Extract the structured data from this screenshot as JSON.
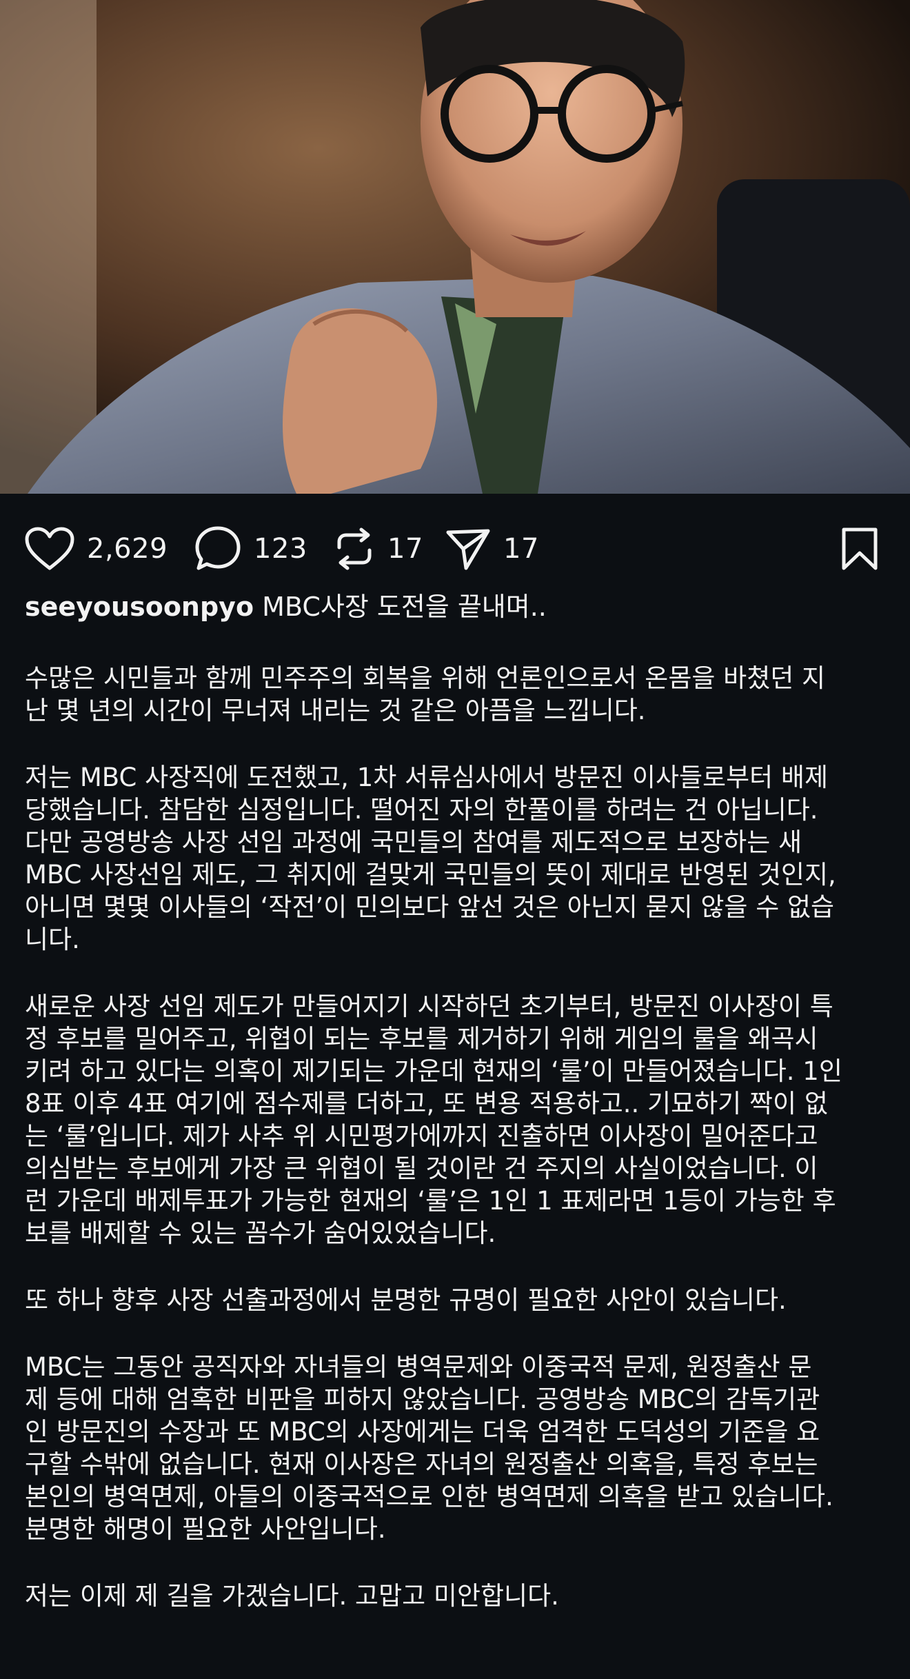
{
  "post": {
    "likes": "2,629",
    "comments": "123",
    "reposts": "17",
    "shares": "17"
  },
  "icons": {
    "like": "heart-icon",
    "comment": "comment-bubble-icon",
    "repost": "repost-icon",
    "share": "send-icon",
    "save": "bookmark-icon"
  },
  "caption": {
    "username": "seeyousoonpyo",
    "headline": "MBC사장 도전을 끝내며..",
    "paragraphs": [
      "수많은 시민들과 함께 민주주의 회복을 위해 언론인으로서 온몸을 바쳤던 지\n난 몇 년의 시간이 무너져 내리는 것 같은 아픔을 느낍니다.",
      "저는 MBC 사장직에 도전했고, 1차 서류심사에서 방문진 이사들로부터 배제\n당했습니다. 참담한 심정입니다. 떨어진 자의 한풀이를 하려는 건 아닙니다.\n다만 공영방송 사장 선임 과정에 국민들의 참여를 제도적으로 보장하는 새\nMBC 사장선임 제도, 그 취지에 걸맞게 국민들의 뜻이 제대로 반영된 것인지,\n아니면 몇몇 이사들의 ‘작전’이 민의보다 앞선 것은 아닌지 묻지 않을 수 없습\n니다.",
      "새로운 사장 선임 제도가 만들어지기 시작하던 초기부터, 방문진 이사장이 특\n정 후보를 밀어주고, 위협이 되는 후보를 제거하기 위해 게임의 룰을 왜곡시\n키려 하고 있다는 의혹이 제기되는 가운데 현재의 ‘룰’이 만들어졌습니다. 1인\n8표 이후 4표 여기에 점수제를 더하고, 또 변용 적용하고.. 기묘하기 짝이 없\n는 ‘룰’입니다. 제가 사추 위 시민평가에까지 진출하면 이사장이 밀어준다고\n의심받는 후보에게 가장 큰 위협이 될 것이란 건 주지의 사실이었습니다. 이\n런 가운데 배제투표가 가능한 현재의 ‘룰’은 1인 1 표제라면 1등이 가능한 후\n보를 배제할 수 있는 꼼수가 숨어있었습니다.",
      "또 하나 향후 사장 선출과정에서 분명한 규명이 필요한 사안이 있습니다.",
      "MBC는 그동안 공직자와 자녀들의 병역문제와 이중국적 문제, 원정출산 문\n제 등에 대해 엄혹한 비판을 피하지 않았습니다. 공영방송 MBC의 감독기관\n인 방문진의 수장과 또 MBC의 사장에게는 더욱 엄격한 도덕성의 기준을 요\n구할 수밖에 없습니다. 현재 이사장은 자녀의 원정출산 의혹을, 특정 후보는\n본인의 병역면제, 아들의 이중국적으로 인한 병역면제 의혹을 받고 있습니다.\n분명한 해명이 필요한 사안입니다.",
      "저는 이제 제 길을 가겠습니다.  고맙고 미안합니다."
    ]
  },
  "colors": {
    "background": "#0c0f13",
    "text": "#f2f2f2"
  }
}
